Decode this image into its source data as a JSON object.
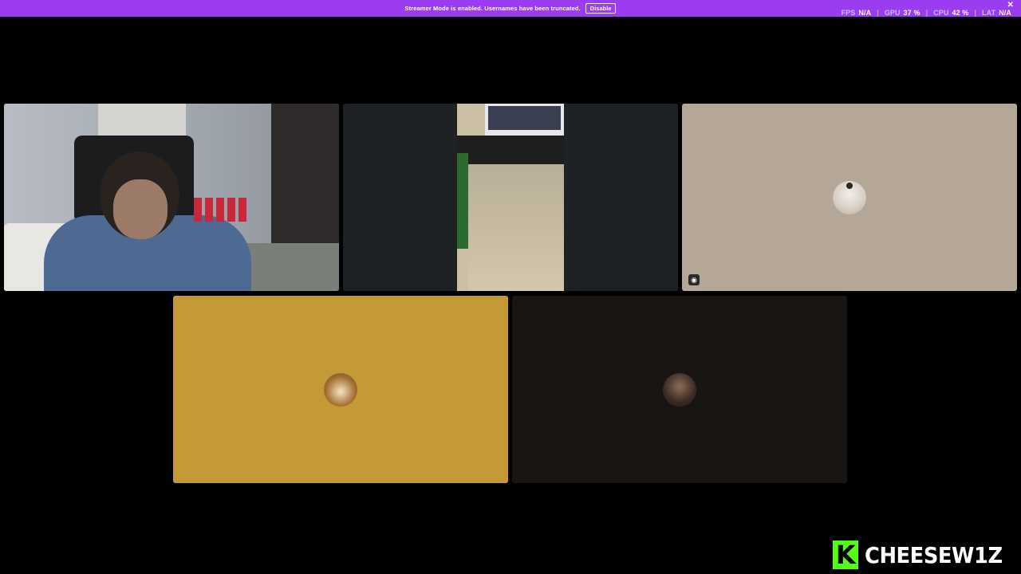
{
  "banner": {
    "message": "Streamer Mode is enabled. Usernames have been truncated.",
    "disable_label": "Disable",
    "close_glyph": "✕",
    "background_color": "#9b3cf0"
  },
  "stats": {
    "fps_label": "FPS",
    "fps_value": "N/A",
    "gpu_label": "GPU",
    "gpu_value": "37 %",
    "cpu_label": "CPU",
    "cpu_value": "42 %",
    "lat_label": "LAT",
    "lat_value": "N/A",
    "separator": "|"
  },
  "tiles": [
    {
      "id": "tile-1",
      "type": "webcam",
      "speaking": true
    },
    {
      "id": "tile-2",
      "type": "screen-share"
    },
    {
      "id": "tile-3",
      "type": "avatar",
      "background": "#b5a797",
      "icon": "stream-icon"
    },
    {
      "id": "tile-4",
      "type": "avatar",
      "background": "#c49a36"
    },
    {
      "id": "tile-5",
      "type": "avatar",
      "background": "#191512"
    }
  ],
  "watermark": {
    "logo_letter": "K",
    "name": "CHEESEW1Z",
    "logo_color": "#53fc18"
  }
}
